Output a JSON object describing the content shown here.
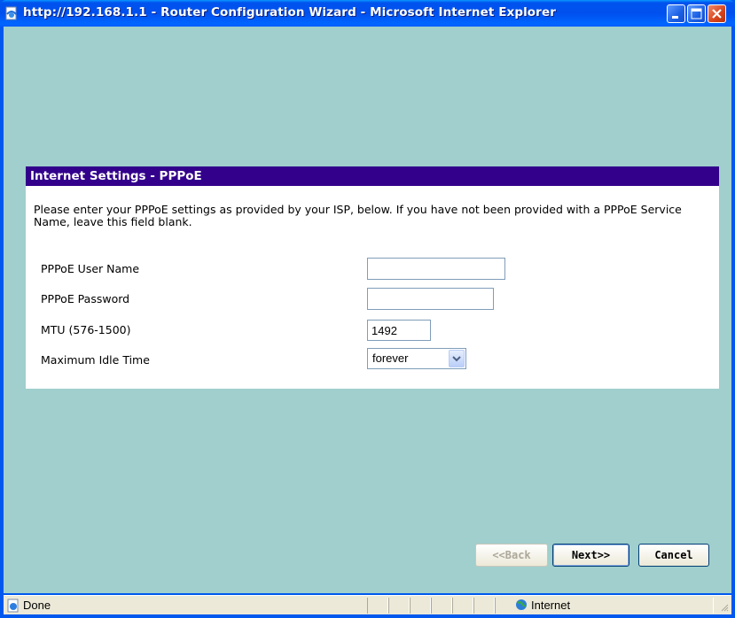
{
  "window": {
    "title": "http://192.168.1.1 - Router Configuration Wizard - Microsoft Internet Explorer"
  },
  "panel": {
    "header": "Internet Settings - PPPoE",
    "description": "Please enter your PPPoE settings as provided by your ISP, below. If you have not been provided with a PPPoE Service Name, leave this field blank.",
    "fields": {
      "username_label": "PPPoE User Name",
      "username_value": "",
      "password_label": "PPPoE Password",
      "password_value": "",
      "mtu_label": "MTU (576-1500)",
      "mtu_value": "1492",
      "idle_label": "Maximum Idle Time",
      "idle_value": "forever"
    }
  },
  "buttons": {
    "back": "<<Back",
    "next": "Next>>",
    "cancel": "Cancel"
  },
  "statusbar": {
    "status": "Done",
    "zone": "Internet"
  },
  "colors": {
    "background": "#a0cfcd",
    "header_bg": "#33008c",
    "titlebar": "#0054e3"
  }
}
